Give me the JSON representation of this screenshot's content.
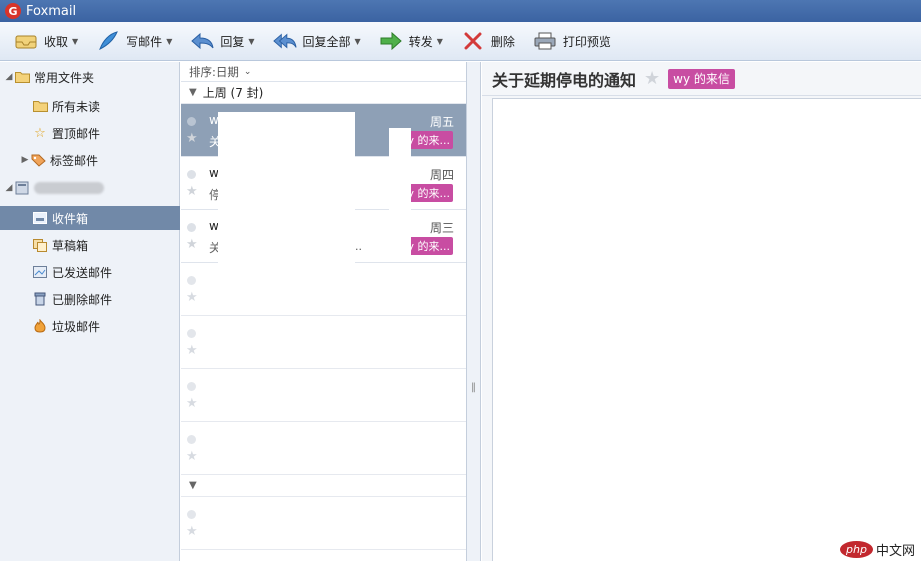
{
  "window": {
    "title": "Foxmail",
    "logo_letter": "G"
  },
  "toolbar": {
    "receive": "收取",
    "compose": "写邮件",
    "reply": "回复",
    "reply_all": "回复全部",
    "forward": "转发",
    "delete": "删除",
    "print_preview": "打印预览"
  },
  "sidebar": {
    "common_folders": "常用文件夹",
    "unread": "所有未读",
    "pinned": "置顶邮件",
    "tag_mail": "标签邮件",
    "inbox": "收件箱",
    "drafts": "草稿箱",
    "sent": "已发送邮件",
    "deleted": "已删除邮件",
    "junk": "垃圾邮件"
  },
  "maillist": {
    "sort_label": "排序:日期",
    "group_label": "上周 (7 封)",
    "mails": [
      {
        "sender": "w",
        "subject": "关",
        "date": "周五",
        "tag": "wy    的来..."
      },
      {
        "sender": "w",
        "subject": "停",
        "date": "周四",
        "tag": "wy    的来..."
      },
      {
        "sender": "w",
        "subject": "关",
        "date": "周三",
        "tag": "wy    的来...",
        "ellipsis": ".."
      }
    ]
  },
  "reader": {
    "subject": "关于延期停电的通知",
    "tag": "wy      的来信"
  },
  "watermark": {
    "logo": "php",
    "text": "中文网"
  }
}
